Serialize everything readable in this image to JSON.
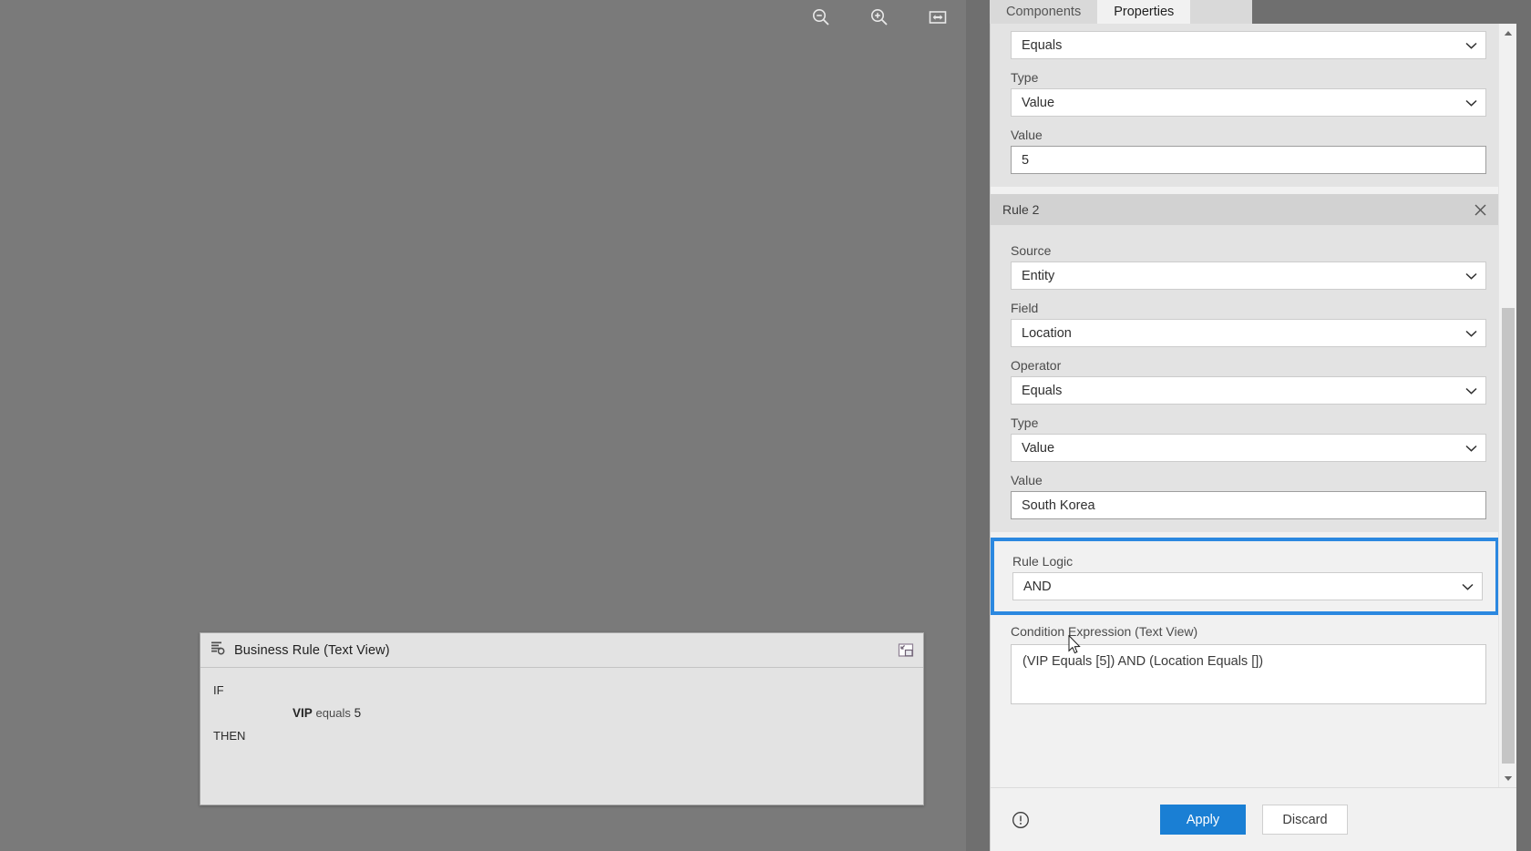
{
  "canvas": {
    "toolbar": [
      {
        "name": "zoom-out-icon",
        "label": "Zoom Out"
      },
      {
        "name": "zoom-in-icon",
        "label": "Zoom In"
      },
      {
        "name": "fit-to-screen-icon",
        "label": "Fit to Screen"
      }
    ],
    "background_color": "#7a7a7a"
  },
  "rule_panel": {
    "title": "Business Rule (Text View)",
    "title_icon": "business-rule-icon",
    "restore_icon": "restore-window-icon",
    "lines": {
      "if": "IF",
      "condition_field": "VIP",
      "condition_operator": "equals",
      "condition_value": "5",
      "then": "THEN"
    }
  },
  "properties_panel": {
    "tabs": [
      {
        "label": "Components",
        "active": false
      },
      {
        "label": "Properties",
        "active": true
      }
    ],
    "rule1_partial": {
      "operator_value": "Equals",
      "type_label": "Type",
      "type_value": "Value",
      "value_label": "Value",
      "value_value": "5"
    },
    "rule2": {
      "header": "Rule 2",
      "close_icon": "close-icon",
      "fields": [
        {
          "label": "Source",
          "value": "Entity",
          "control": "select"
        },
        {
          "label": "Field",
          "value": "Location",
          "control": "select"
        },
        {
          "label": "Operator",
          "value": "Equals",
          "control": "select"
        },
        {
          "label": "Type",
          "value": "Value",
          "control": "select"
        },
        {
          "label": "Value",
          "value": "South Korea",
          "control": "input"
        }
      ]
    },
    "rule_logic": {
      "label": "Rule Logic",
      "value": "AND",
      "highlight_color": "#2b88e0"
    },
    "condition_expression": {
      "label": "Condition Expression (Text View)",
      "value": "(VIP Equals [5]) AND (Location Equals [])"
    },
    "scrollbar": {
      "up_arrow_icon": "scroll-up-icon",
      "down_arrow_icon": "scroll-down-icon"
    },
    "actions": {
      "info_icon": "warning-info-icon",
      "apply_label": "Apply",
      "discard_label": "Discard",
      "apply_color": "#1a7fd4"
    }
  }
}
